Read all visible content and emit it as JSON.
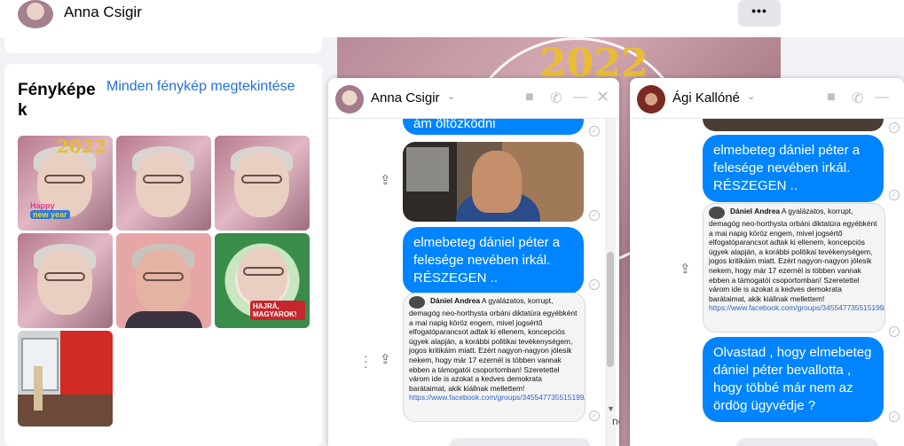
{
  "header": {
    "title": "Anna Csigir",
    "more_glyph": "•••"
  },
  "photos": {
    "title": "Fényképek",
    "see_all": "Minden fénykép megtekintése",
    "stickers": {
      "year": "2022",
      "happy": "Happy",
      "new_year": "new year",
      "hajra": "HAJRÁ, MAGYAROK!"
    }
  },
  "background": {
    "year": "2022"
  },
  "chat1": {
    "name": "Anna Csigir",
    "partial_text": "ám öltözködni",
    "bubble": "elmebeteg dániel péter a felesége nevében irkál. RÉSZEGEN ..",
    "post": {
      "author": "Dániel Andrea",
      "text": "A gyalázatos, korrupt, demagóg neo-horthysta orbáni diktatúra egyébként a mai napig köröz engem, mivel jogsértő elfogatóparancsot adtak ki ellenem, koncepciós ügyek alapján, a korábbi politikai tevékenységem, jogos kritikáim miatt. Ezért nagyon-nagyon jólesik nekem, hogy már 17 ezernél is többen vannak ebben a támogatói csoportomban! Szeretettel várom ide is azokat a kedves demokrata barátaimat, akik kiállnak mellettem!",
      "link": "https://www.facebook.com/groups/345547735515199/"
    },
    "side_text": "no"
  },
  "chat2": {
    "name": "Ági Kallóné",
    "bubble1": "elmebeteg dániel péter a felesége nevében irkál. RÉSZEGEN ..",
    "post": {
      "author": "Dániel Andrea",
      "text": "A gyalázatos, korrupt, demagóg neo-horthysta orbáni diktatúra egyébként a mai napig köröz engem, mivel jogsértő elfogatóparancsot adtak ki ellenem, koncepciós ügyek alapján, a korábbi politikai tevékenységem, jogos kritikáim miatt. Ezért nagyon-nagyon jólesik nekem, hogy már 17 ezernél is többen vannak ebben a támogatói csoportomban! Szeretettel várom ide is azokat a kedves demokrata barátaimat, akik kiállnak mellettem!",
      "link": "https://www.facebook.com/groups/345547735515199/"
    },
    "bubble2": "Olvastad , hogy elmebeteg dániel péter bevallotta , hogy többé már nem az ördög ügyvédje ?"
  },
  "colors": {
    "messenger_blue": "#0084ff",
    "link_blue": "#216fdb",
    "bg": "#f0f2f5"
  }
}
